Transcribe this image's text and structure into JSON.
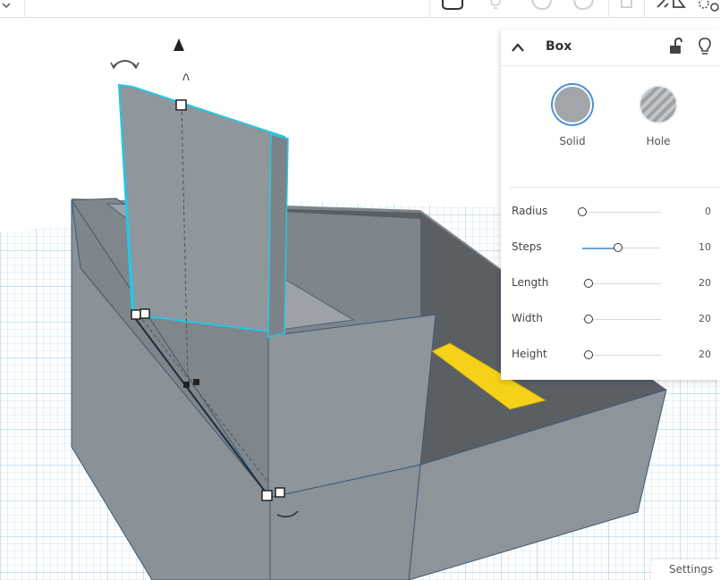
{
  "toolbar": {
    "icons": [
      "dropdown-chevron-icon",
      "comment-icon",
      "lightbulb-icon",
      "undo-icon",
      "redo-icon",
      "flag-icon",
      "mirror-icon",
      "group-icon"
    ]
  },
  "panel": {
    "title": "Box",
    "solid_label": "Solid",
    "hole_label": "Hole",
    "properties": [
      {
        "label": "Radius",
        "value": "0",
        "fraction": 0.0
      },
      {
        "label": "Steps",
        "value": "10",
        "fraction": 0.45
      },
      {
        "label": "Length",
        "value": "20",
        "fraction": 0.08
      },
      {
        "label": "Width",
        "value": "20",
        "fraction": 0.08
      },
      {
        "label": "Height",
        "value": "20",
        "fraction": 0.08
      }
    ]
  },
  "settings_label": "Settings",
  "colors": {
    "grid_background": "#cfe9f5",
    "box_face": "#8c9399",
    "box_top": "#5a5f64",
    "selection_outline": "#26c6e6",
    "yellow_shape": "#f5d11a",
    "slider_accent": "#6ea6d6"
  }
}
